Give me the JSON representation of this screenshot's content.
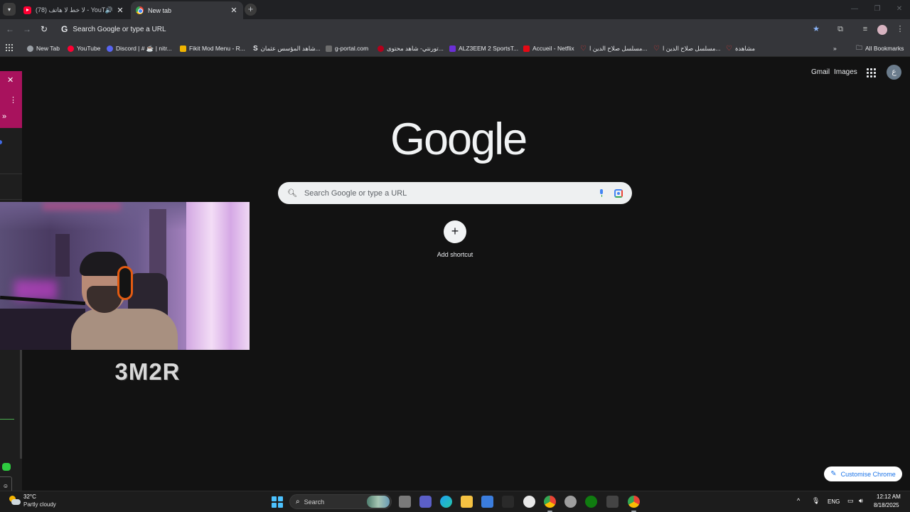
{
  "tabs": [
    {
      "title": "(78) لا خط لا هاتف - YouTube",
      "favicon": "youtube-icon",
      "audio": true,
      "active": false
    },
    {
      "title": "New tab",
      "favicon": "chrome-icon",
      "active": true
    }
  ],
  "omnibox": {
    "placeholder": "Search Google or type a URL"
  },
  "bookmarks": [
    {
      "label": "New Tab",
      "icon": "chrome-icon",
      "color": "#9aa0a6"
    },
    {
      "label": "YouTube",
      "icon": "youtube-icon",
      "color": "#ff0033"
    },
    {
      "label": "Discord | # ☕ | nitr...",
      "icon": "discord-icon",
      "color": "#5865f2"
    },
    {
      "label": "Fikit Mod Menu - R...",
      "icon": "crown-icon",
      "color": "#f0b400"
    },
    {
      "label": "شاهد المؤسس عثمان...",
      "icon": "s-icon",
      "color": "#e8eaed"
    },
    {
      "label": "g-portal.com",
      "icon": "gportal-icon",
      "color": "#6d6d6d"
    },
    {
      "label": "تورنتي- شاهد محتوى...",
      "icon": "red-icon",
      "color": "#b3001b"
    },
    {
      "label": "ALZ3EEM 2 SportsT...",
      "icon": "v-icon",
      "color": "#6b2fd6"
    },
    {
      "label": "Accueil - Netflix",
      "icon": "netflix-icon",
      "color": "#e50914"
    },
    {
      "label": "مسلسل صلاح الدين ا...",
      "icon": "heart-icon",
      "color": "#e53935"
    },
    {
      "label": "مسلسل صلاح الدين ا...",
      "icon": "heart-icon",
      "color": "#e53935"
    },
    {
      "label": "مشاهدة",
      "icon": "heart-icon",
      "color": "#e53935"
    }
  ],
  "all_bookmarks": "All Bookmarks",
  "page": {
    "gmail": "Gmail",
    "images": "Images",
    "account_initial": "ع",
    "logo": "Google",
    "search_placeholder": "Search Google or type a URL",
    "add_shortcut": "Add shortcut",
    "customise": "Customise Chrome"
  },
  "overlay": {
    "streamer_name": "3M2R"
  },
  "taskbar": {
    "temperature": "32°C",
    "weather": "Partly cloudy",
    "search": "Search",
    "language": "ENG",
    "time": "12:12 AM",
    "date": "8/18/2025"
  },
  "colors": {
    "page_bg": "#121212",
    "accent": "#1a73e8",
    "side_accent": "#a8125d"
  }
}
